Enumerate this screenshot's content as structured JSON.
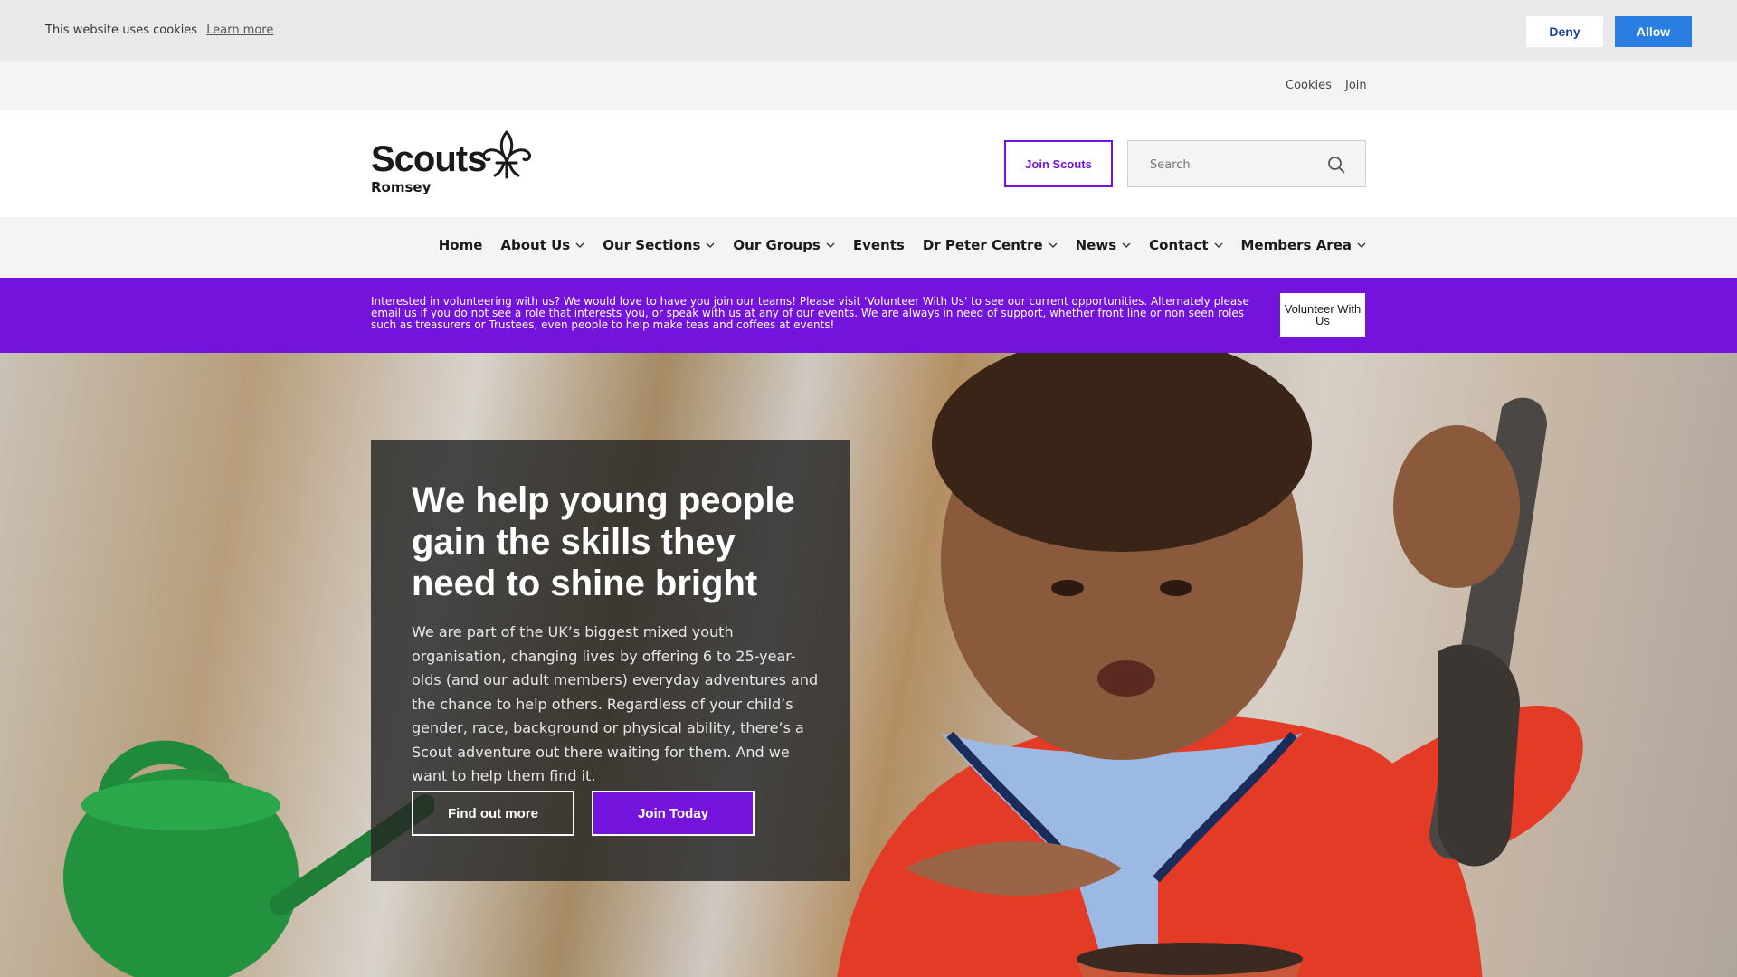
{
  "cookie_bar": {
    "text": "This website uses cookies",
    "learn_more": "Learn more",
    "deny": "Deny",
    "allow": "Allow"
  },
  "utility_nav": {
    "cookies": "Cookies",
    "join": "Join"
  },
  "header": {
    "logo_word": "Scouts",
    "logo_sub": "Romsey",
    "join_button": "Join Scouts",
    "search_placeholder": "Search"
  },
  "nav": {
    "items": [
      {
        "label": "Home",
        "dropdown": false
      },
      {
        "label": "About Us",
        "dropdown": true
      },
      {
        "label": "Our Sections",
        "dropdown": true
      },
      {
        "label": "Our Groups",
        "dropdown": true
      },
      {
        "label": "Events",
        "dropdown": false
      },
      {
        "label": "Dr Peter Centre",
        "dropdown": true
      },
      {
        "label": "News",
        "dropdown": true
      },
      {
        "label": "Contact",
        "dropdown": true
      },
      {
        "label": "Members Area",
        "dropdown": true
      }
    ]
  },
  "banner": {
    "text": "Interested in volunteering with us? We would love to have you join our teams! Please visit 'Volunteer With Us' to see our current opportunities. Alternately please email us if you do not see a role that interests you, or speak with us at any of our events. We are always in need of support, whether front line or non seen roles such as treasurers or Trustees, even people to help make teas and coffees at events!",
    "button": "Volunteer With Us"
  },
  "hero": {
    "title": "We help young people gain the skills they need to shine bright",
    "body": "We are part of the UK’s biggest mixed youth organisation, changing lives by offering 6 to 25-year-olds (and our adult members) everyday adventures and the chance to help others. Regardless of your child’s gender, race, background or physical ability, there’s a Scout adventure out there waiting for them. And we want to help them find it.",
    "find_out_more": "Find out more",
    "join_today": "Join Today"
  },
  "colors": {
    "brand_purple": "#7413dc",
    "allow_blue": "#2a7de1",
    "cookie_bg": "#e9e9e9"
  },
  "icons": {
    "logo": "fleur-de-lis-icon",
    "search": "search-icon",
    "dropdown": "chevron-down-icon"
  }
}
